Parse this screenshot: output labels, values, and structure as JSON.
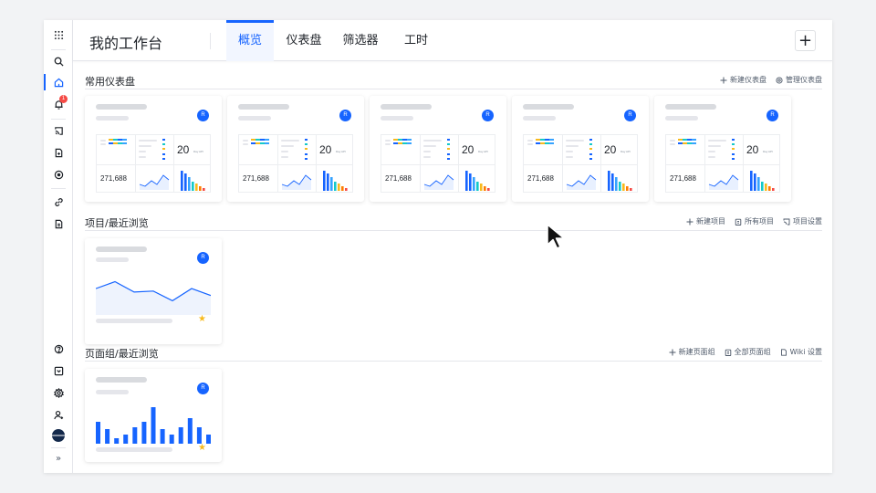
{
  "header": {
    "title": "我的工作台",
    "tabs": [
      {
        "label": "概览",
        "active": true
      },
      {
        "label": "仪表盘",
        "active": false
      },
      {
        "label": "筛选器",
        "active": false
      },
      {
        "label": "工时",
        "active": false
      }
    ],
    "add_label": "+"
  },
  "sidebar": {
    "top_items": [
      "apps-icon",
      "search-icon",
      "home-icon",
      "bell-icon",
      "cast-icon",
      "doc-icon",
      "compass-icon",
      "link-icon",
      "file-icon"
    ],
    "bottom_items": [
      "help-icon",
      "inbox-icon",
      "gear-icon",
      "user-add-icon",
      "avatar",
      "expand-icon"
    ],
    "notification_count": "1",
    "expand_label": "»"
  },
  "sections": {
    "dashboards": {
      "title": "常用仪表盘",
      "actions": [
        {
          "icon": "plus-icon",
          "label": "新建仪表盘"
        },
        {
          "icon": "gear-icon",
          "label": "管理仪表盘"
        }
      ]
    },
    "projects": {
      "title": "项目/最近浏览",
      "actions": [
        {
          "icon": "plus-icon",
          "label": "新建项目"
        },
        {
          "icon": "clipboard-icon",
          "label": "所有项目"
        },
        {
          "icon": "cast-icon",
          "label": "项目设置"
        }
      ]
    },
    "pagegroups": {
      "title": "页面组/最近浏览",
      "actions": [
        {
          "icon": "plus-icon",
          "label": "新建页面组"
        },
        {
          "icon": "clipboard-icon",
          "label": "全部页面组"
        },
        {
          "icon": "file-icon",
          "label": "Wiki 设置"
        }
      ]
    }
  },
  "dashboard_card": {
    "badge": "R",
    "kpi_value": "20",
    "kpi_unit": "Day API",
    "metric_value": "271,688"
  },
  "project_card": {
    "badge": "R",
    "starred": true,
    "line_values": [
      0.55,
      0.75,
      0.45,
      0.48,
      0.2,
      0.55,
      0.35
    ]
  },
  "pagegroup_card": {
    "badge": "R",
    "starred": true,
    "bar_values": [
      0.6,
      0.4,
      0.15,
      0.25,
      0.45,
      0.6,
      1.0,
      0.4,
      0.25,
      0.45,
      0.7,
      0.45,
      0.25
    ]
  },
  "colors": {
    "accent": "#1664ff",
    "star": "#f7ba1e",
    "badge": "#f54a45"
  }
}
